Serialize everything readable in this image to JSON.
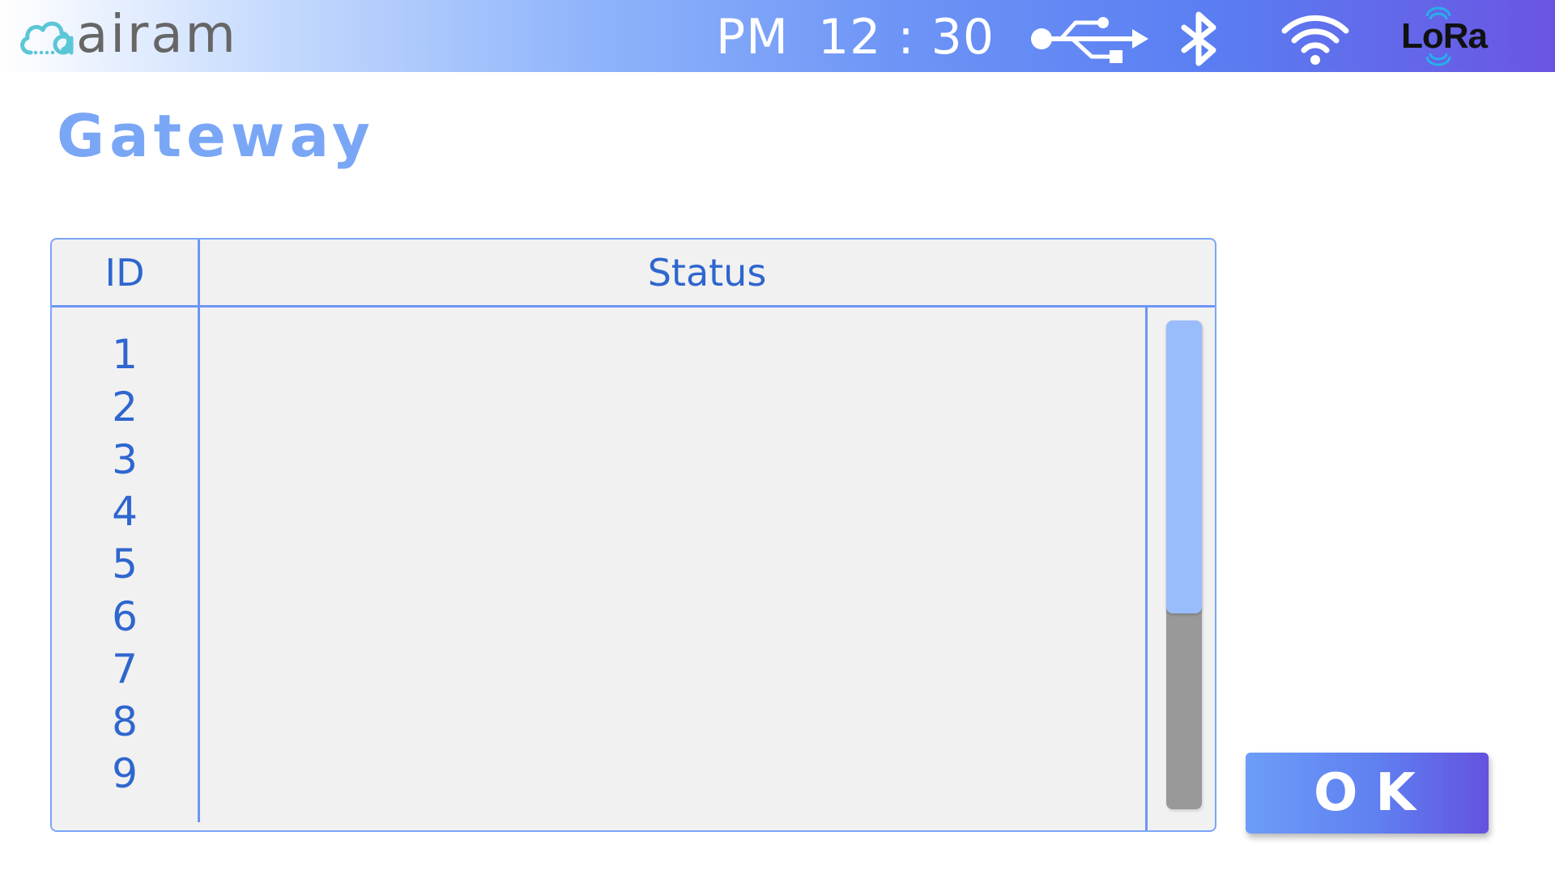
{
  "statusbar": {
    "logo_text": "airam",
    "clock": {
      "ampm": "PM",
      "time": "12 : 30"
    },
    "icons": [
      "usb-icon",
      "bluetooth-icon",
      "wifi-icon",
      "lora-icon"
    ],
    "lora_label": "LoRa"
  },
  "page": {
    "title": "Gateway"
  },
  "table": {
    "columns": [
      "ID",
      "Status"
    ],
    "rows": [
      {
        "id": "1",
        "status": ""
      },
      {
        "id": "2",
        "status": ""
      },
      {
        "id": "3",
        "status": ""
      },
      {
        "id": "4",
        "status": ""
      },
      {
        "id": "5",
        "status": ""
      },
      {
        "id": "6",
        "status": ""
      },
      {
        "id": "7",
        "status": ""
      },
      {
        "id": "8",
        "status": ""
      },
      {
        "id": "9",
        "status": ""
      }
    ],
    "scroll_position_fraction": 0.0,
    "scroll_visible_fraction": 0.6
  },
  "actions": {
    "ok_label": "OK"
  },
  "colors": {
    "accent": "#7aa6f6",
    "text_blue": "#2f66cf",
    "table_bg": "#f1f1f1",
    "scroll_thumb": "#99bdfb",
    "scroll_track": "#999999",
    "logo_cloud": "#5bc6d6",
    "logo_text": "#666666"
  }
}
